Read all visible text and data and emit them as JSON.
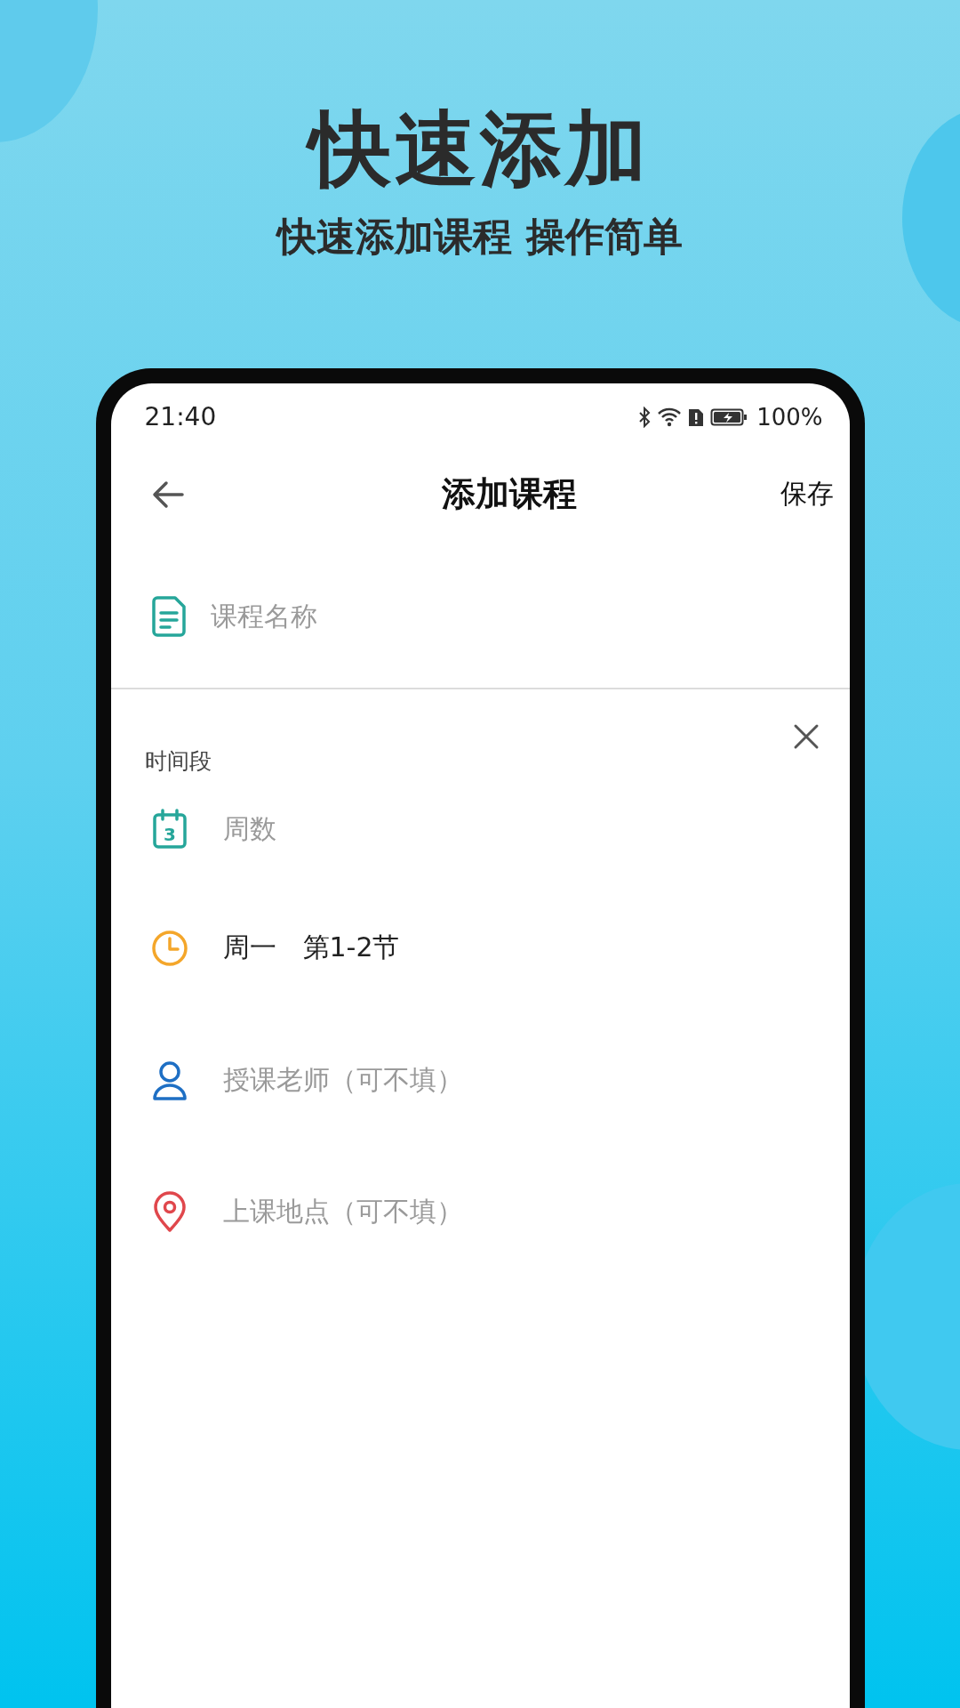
{
  "promo": {
    "title": "快速添加",
    "subtitle": "快速添加课程 操作简单"
  },
  "status_bar": {
    "time": "21:40",
    "battery": "100%"
  },
  "nav": {
    "title": "添加课程",
    "action": "保存"
  },
  "course_name": {
    "placeholder": "课程名称"
  },
  "section": {
    "label": "时间段"
  },
  "calendar_day": "3",
  "rows": [
    {
      "kind": "weeks",
      "placeholder": "周数"
    },
    {
      "kind": "time",
      "value": "周一　第1-2节"
    },
    {
      "kind": "teacher",
      "placeholder": "授课老师（可不填）"
    },
    {
      "kind": "place",
      "placeholder": "上课地点（可不填）"
    }
  ]
}
